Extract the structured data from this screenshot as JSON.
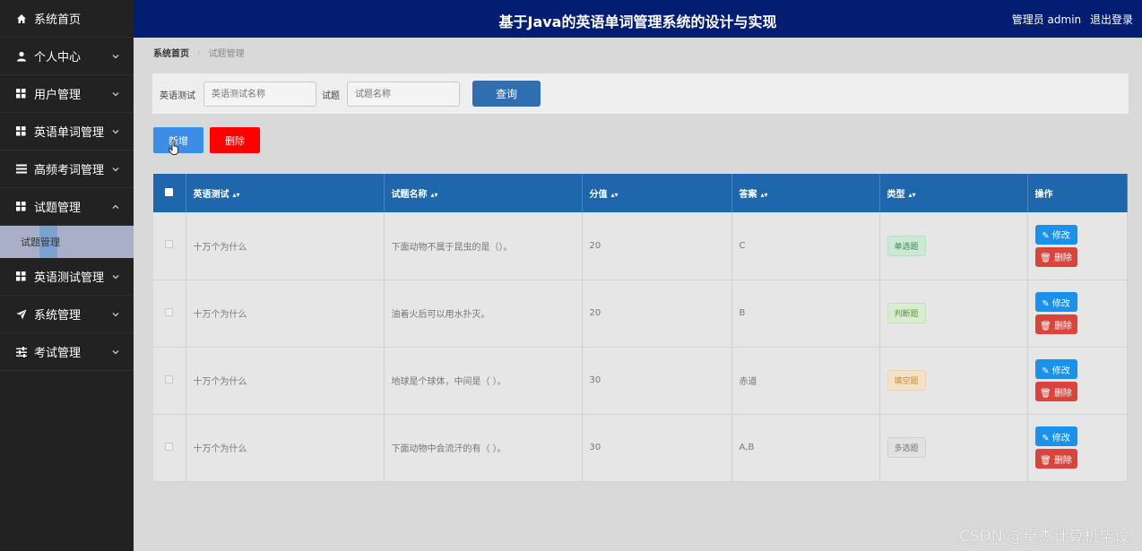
{
  "header": {
    "title": "基于Java的英语单词管理系统的设计与实现",
    "user_label": "管理员 admin",
    "logout": "退出登录"
  },
  "sidebar": {
    "items": [
      {
        "label": "系统首页"
      },
      {
        "label": "个人中心"
      },
      {
        "label": "用户管理"
      },
      {
        "label": "英语单词管理"
      },
      {
        "label": "高频考词管理"
      },
      {
        "label": "试题管理"
      },
      {
        "label": "英语测试管理"
      },
      {
        "label": "系统管理"
      },
      {
        "label": "考试管理"
      }
    ],
    "sub_item": "试题管理"
  },
  "breadcrumb": {
    "home": "系统首页",
    "current": "试题管理"
  },
  "search": {
    "label1": "英语测试",
    "placeholder1": "英语测试名称",
    "label2": "试题",
    "placeholder2": "试题名称",
    "query": "查询"
  },
  "actions": {
    "add": "新增",
    "delete": "删除"
  },
  "table": {
    "headers": [
      "英语测试",
      "试题名称",
      "分值",
      "答案",
      "类型",
      "操作"
    ],
    "rows": [
      {
        "test": "十万个为什么",
        "name": "下面动物不属于昆虫的是（）。",
        "score": "20",
        "answer": "C",
        "type": "单选题"
      },
      {
        "test": "十万个为什么",
        "name": "油着火后可以用水扑灭。",
        "score": "20",
        "answer": "B",
        "type": "判断题"
      },
      {
        "test": "十万个为什么",
        "name": "地球是个球体，中间是（ ）。",
        "score": "30",
        "answer": "赤道",
        "type": "填空题"
      },
      {
        "test": "十万个为什么",
        "name": "下面动物中会流汗的有（ ）。",
        "score": "30",
        "answer": "A,B",
        "type": "多选题"
      }
    ],
    "edit_label": "修改",
    "delete_label": "删除"
  },
  "watermark": "CSDN @卓杰计算机毕设"
}
